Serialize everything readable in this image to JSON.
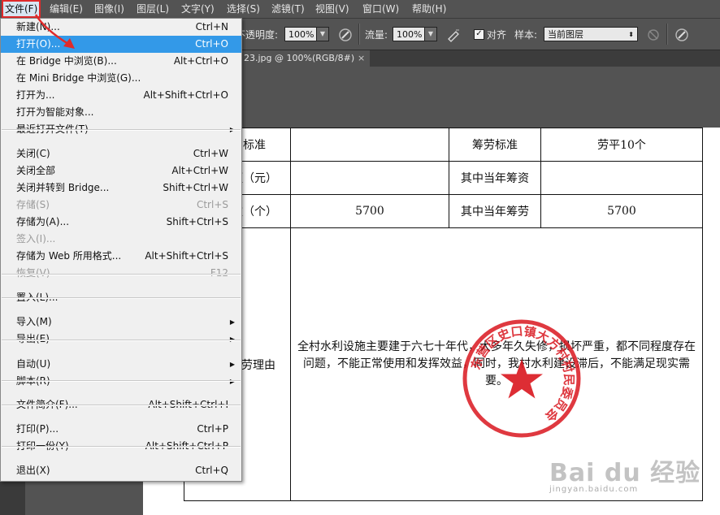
{
  "menubar": {
    "items": [
      "文件(F)",
      "编辑(E)",
      "图像(I)",
      "图层(L)",
      "文字(Y)",
      "选择(S)",
      "滤镜(T)",
      "视图(V)",
      "窗口(W)",
      "帮助(H)"
    ]
  },
  "options": {
    "opacity_label": "不透明度:",
    "opacity_value": "100%",
    "flow_label": "流量:",
    "flow_value": "100%",
    "align_label": "对齐",
    "align_checked": true,
    "sample_label": "样本:",
    "sample_value": "当前图层"
  },
  "tab": {
    "title": "23.jpg @ 100%(RGB/8#)",
    "close": "×"
  },
  "file_menu": {
    "groups": [
      [
        {
          "label": "新建(N)...",
          "shortcut": "Ctrl+N"
        },
        {
          "label": "打开(O)...",
          "shortcut": "Ctrl+O",
          "highlighted": true
        },
        {
          "label": "在 Bridge 中浏览(B)...",
          "shortcut": "Alt+Ctrl+O"
        },
        {
          "label": "在 Mini Bridge 中浏览(G)...",
          "shortcut": ""
        },
        {
          "label": "打开为...",
          "shortcut": "Alt+Shift+Ctrl+O"
        },
        {
          "label": "打开为智能对象...",
          "shortcut": ""
        },
        {
          "label": "最近打开文件(T)",
          "shortcut": "",
          "submenu": true
        }
      ],
      [
        {
          "label": "关闭(C)",
          "shortcut": "Ctrl+W"
        },
        {
          "label": "关闭全部",
          "shortcut": "Alt+Ctrl+W"
        },
        {
          "label": "关闭并转到 Bridge...",
          "shortcut": "Shift+Ctrl+W"
        },
        {
          "label": "存储(S)",
          "shortcut": "Ctrl+S",
          "disabled": true
        },
        {
          "label": "存储为(A)...",
          "shortcut": "Shift+Ctrl+S"
        },
        {
          "label": "签入(I)...",
          "shortcut": "",
          "disabled": true
        },
        {
          "label": "存储为 Web 所用格式...",
          "shortcut": "Alt+Shift+Ctrl+S"
        },
        {
          "label": "恢复(V)",
          "shortcut": "F12",
          "disabled": true
        }
      ],
      [
        {
          "label": "置入(L)...",
          "shortcut": ""
        }
      ],
      [
        {
          "label": "导入(M)",
          "shortcut": "",
          "submenu": true
        },
        {
          "label": "导出(E)",
          "shortcut": "",
          "submenu": true
        }
      ],
      [
        {
          "label": "自动(U)",
          "shortcut": "",
          "submenu": true
        },
        {
          "label": "脚本(R)",
          "shortcut": "",
          "submenu": true
        }
      ],
      [
        {
          "label": "文件简介(F)...",
          "shortcut": "Alt+Shift+Ctrl+I"
        }
      ],
      [
        {
          "label": "打印(P)...",
          "shortcut": "Ctrl+P"
        },
        {
          "label": "打印一份(Y)",
          "shortcut": "Alt+Shift+Ctrl+P"
        }
      ],
      [
        {
          "label": "退出(X)",
          "shortcut": "Ctrl+Q"
        }
      ]
    ]
  },
  "document": {
    "r1": [
      "标准",
      "",
      "筹劳标准",
      "劳平10个"
    ],
    "r2": [
      "额（元）",
      "",
      "其中当年筹资",
      ""
    ],
    "r3": [
      "数（个）",
      "5700",
      "其中当年筹劳",
      "5700"
    ],
    "r4_left": "劳理由",
    "reason": "全村水利设施主要建于六七十年代，大多年久失修，损坏严重，都不同程度存在问题，不能正常使用和发挥效益，同时，我村水利建设滞后，不能满足现实需要。",
    "seal_text": "东营区史口镇大方村村民委员会"
  },
  "watermark": {
    "main": "Bai du 经验",
    "url": "jingyan.baidu.com"
  },
  "colors": {
    "highlight": "#3399e8",
    "annotation_red": "#e02a2a",
    "seal_red": "#d9161e"
  }
}
